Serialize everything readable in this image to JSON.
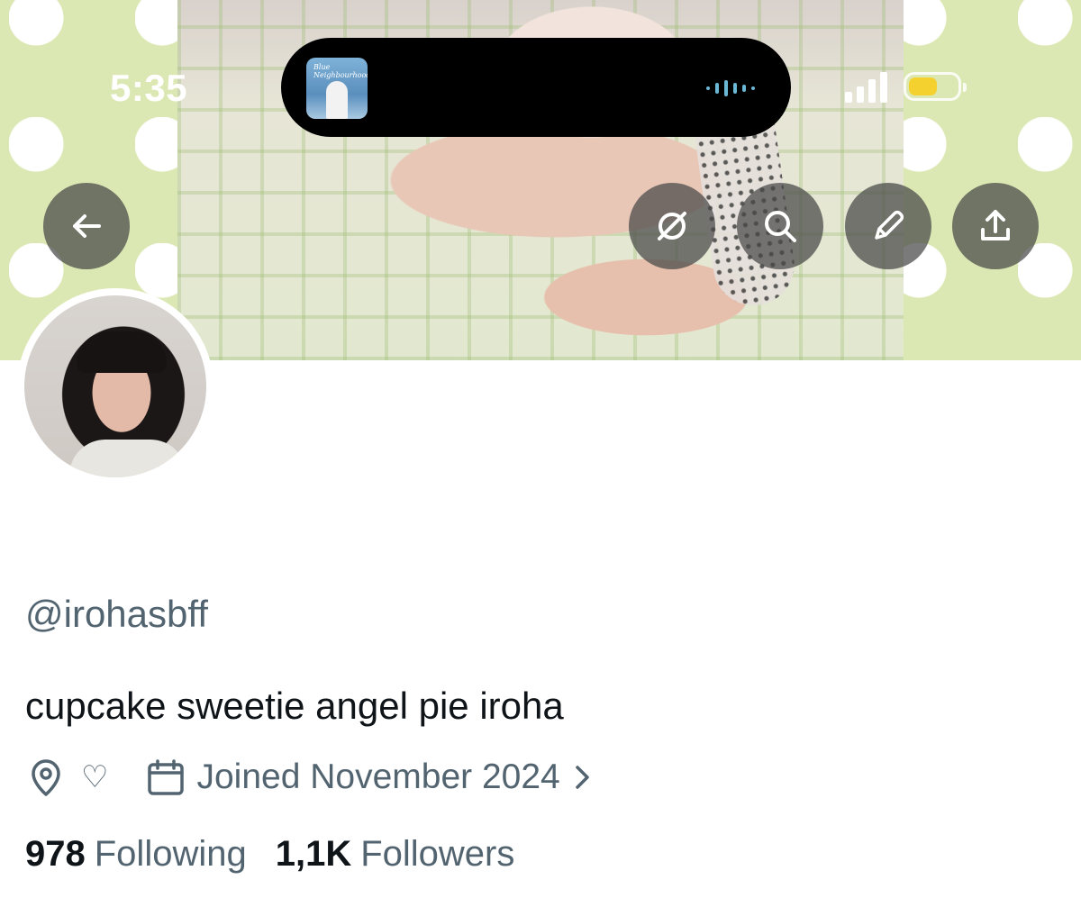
{
  "status_bar": {
    "time": "5:35",
    "album_caption": "Blue Neighbourhood",
    "battery_level_percent": 60,
    "battery_color": "#f5d130"
  },
  "banner_actions": {
    "back_icon": "arrow-left-icon",
    "grok_icon": "grok-icon",
    "search_icon": "search-icon",
    "edit_icon": "pencil-icon",
    "share_icon": "share-icon"
  },
  "profile": {
    "handle": "@irohasbff",
    "bio": "cupcake sweetie angel pie iroha",
    "location_text": "♡",
    "joined": "Joined November 2024",
    "following_count": "978",
    "following_label": "Following",
    "followers_count": "1,1K",
    "followers_label": "Followers"
  },
  "colors": {
    "secondary_text": "#536471",
    "primary_text": "#0f1419",
    "banner_green": "#dce8b4"
  }
}
